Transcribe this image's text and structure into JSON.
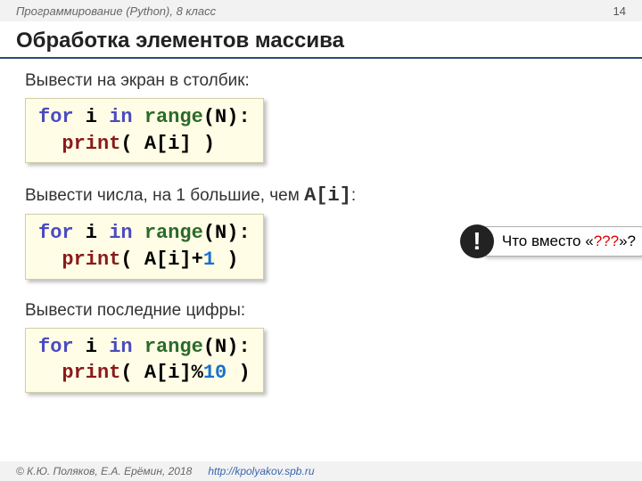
{
  "header": {
    "course": "Программирование (Python), 8 класс",
    "page": "14"
  },
  "title": "Обработка элементов массива",
  "sections": {
    "s1_label": "Вывести на экран в столбик:",
    "s2_label_a": "Вывести числа, на 1 большие, чем ",
    "s2_label_b": "A[i]",
    "s2_label_c": ":",
    "s3_label": "Вывести последние цифры:"
  },
  "code": {
    "c1_l1a": "for",
    "c1_l1b": " i ",
    "c1_l1c": "in",
    "c1_l1d": " ",
    "c1_l1e": "range",
    "c1_l1f": "(N):",
    "c1_l2a": "  ",
    "c1_l2b": "print",
    "c1_l2c": "( A[i] )",
    "c2_l2a": "  ",
    "c2_l2b": "print",
    "c2_l2c": "( A[i]+",
    "c2_l2d": "1",
    "c2_l2e": " )",
    "c3_l2a": "  ",
    "c3_l2b": "print",
    "c3_l2c": "( A[i]%",
    "c3_l2d": "10",
    "c3_l2e": " )"
  },
  "callout": {
    "badge": "!",
    "text_a": "Что вместо «",
    "text_q": "???",
    "text_b": "»? "
  },
  "footer": {
    "copyright": "© К.Ю. Поляков, Е.А. Ерёмин, 2018",
    "url": "http://kpolyakov.spb.ru"
  }
}
